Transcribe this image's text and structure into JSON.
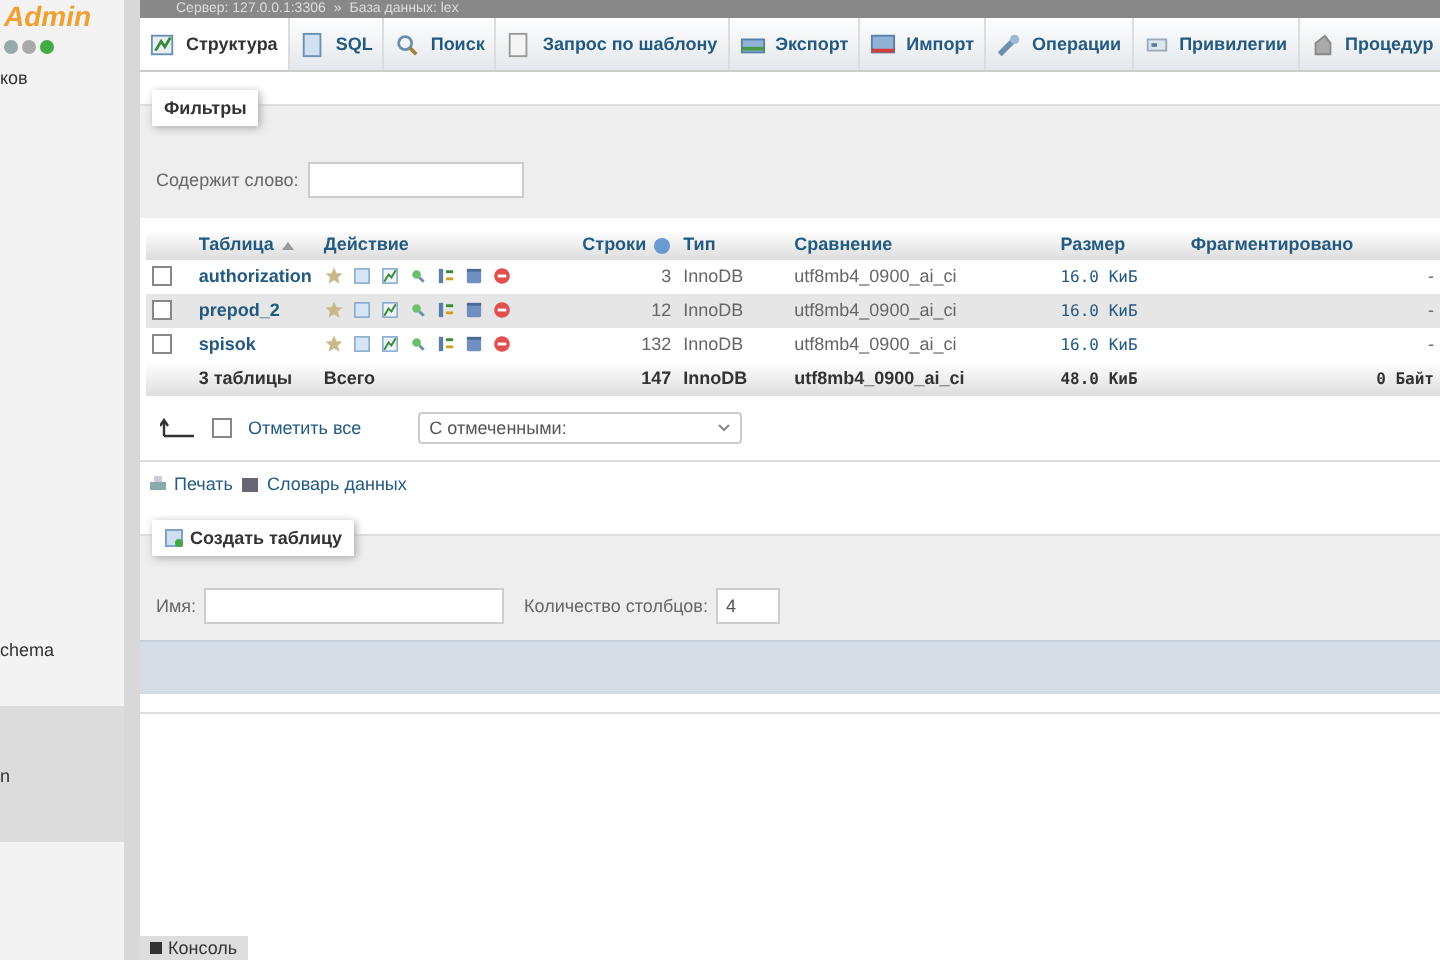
{
  "breadcrumb": {
    "server": "Сервер: 127.0.0.1:3306",
    "separator": "»",
    "database": "База данных: lex"
  },
  "sidebar": {
    "logo": "Admin",
    "items": [
      {
        "label": "ков",
        "selected": false
      },
      {
        "label": "chema",
        "selected": false
      },
      {
        "label": "n",
        "selected": true
      }
    ]
  },
  "tabs": [
    {
      "label": "Структура",
      "selected": true
    },
    {
      "label": "SQL",
      "selected": false
    },
    {
      "label": "Поиск",
      "selected": false
    },
    {
      "label": "Запрос по шаблону",
      "selected": false
    },
    {
      "label": "Экспорт",
      "selected": false
    },
    {
      "label": "Импорт",
      "selected": false
    },
    {
      "label": "Операции",
      "selected": false
    },
    {
      "label": "Привилегии",
      "selected": false
    },
    {
      "label": "Процедур",
      "selected": false
    }
  ],
  "filters": {
    "title": "Фильтры",
    "label": "Содержит слово:"
  },
  "table": {
    "columns": [
      "Таблица",
      "Действие",
      "Строки",
      "Тип",
      "Сравнение",
      "Размер",
      "Фрагментировано"
    ],
    "rows": [
      {
        "name": "authorization",
        "checked": false,
        "rows": "3",
        "type": "InnoDB",
        "collation": "utf8mb4_0900_ai_ci",
        "size": "16.0 КиБ",
        "overhead": "-"
      },
      {
        "name": "prepod_2",
        "checked": false,
        "rows": "12",
        "type": "InnoDB",
        "collation": "utf8mb4_0900_ai_ci",
        "size": "16.0 КиБ",
        "overhead": "-"
      },
      {
        "name": "spisok",
        "checked": false,
        "rows": "132",
        "type": "InnoDB",
        "collation": "utf8mb4_0900_ai_ci",
        "size": "16.0 КиБ",
        "overhead": "-"
      }
    ],
    "footer": {
      "count": "3 таблицы",
      "label": "Всего",
      "rows": "147",
      "type": "InnoDB",
      "collation": "utf8mb4_0900_ai_ci",
      "size": "48.0 КиБ",
      "overhead": "0 Байт"
    }
  },
  "bulk": {
    "check_all": "Отметить все",
    "checked": false,
    "action": "С отмеченными:"
  },
  "links": [
    "Печать",
    "Словарь данных"
  ],
  "create": {
    "title": "Создать таблицу",
    "name_label": "Имя:",
    "columns_label": "Количество столбцов:",
    "columns_value": "4"
  },
  "console": "Консоль"
}
